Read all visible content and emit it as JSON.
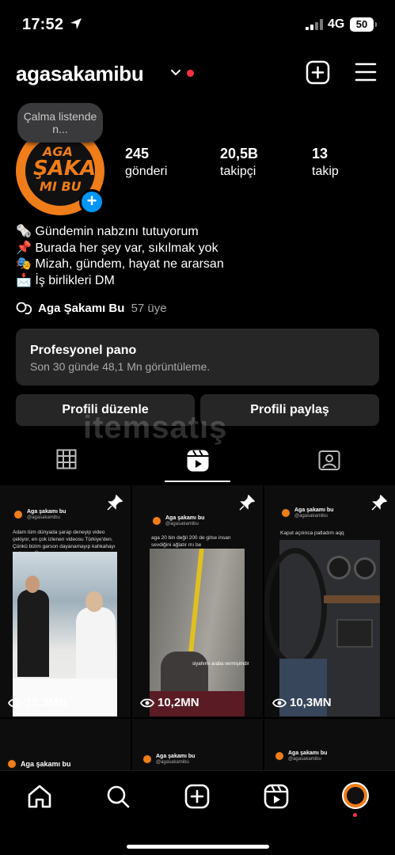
{
  "status_bar": {
    "time": "17:52",
    "network": "4G",
    "battery": "50"
  },
  "header": {
    "username": "agasakamibu"
  },
  "note": {
    "text": "Çalma listende n..."
  },
  "avatar": {
    "logo_lines": [
      "AGA",
      "ŞAKA",
      "MI BU"
    ]
  },
  "stats": [
    {
      "value": "245",
      "label": "gönderi"
    },
    {
      "value": "20,5B",
      "label": "takipçi"
    },
    {
      "value": "13",
      "label": "takip"
    }
  ],
  "bio": [
    "🗞️ Gündemin nabzını tutuyorum",
    "📌 Burada her şey var, sıkılmak yok",
    "🎭 Mizah, gündem, hayat ne ararsan",
    "📩 İş birlikleri DM"
  ],
  "community": {
    "name": "Aga Şakamı Bu",
    "count": "57 üye"
  },
  "professional_dashboard": {
    "title": "Profesyonel pano",
    "subtitle": "Son 30 günde 48,1 Mn görüntüleme."
  },
  "buttons": {
    "edit_profile": "Profili düzenle",
    "share_profile": "Profili paylaş"
  },
  "watermark": "itemsatış",
  "grid": [
    {
      "account_name": "Aga şakamı bu",
      "handle": "@agasakamibu",
      "caption": "Adam tüm dünyada şarap deneyip video çekiyor, en çok izlenen videosu Türkiye'den. Çünkü bizim garson dayanamayıp kahkahayı patlatıyo 😂",
      "views": "12,3MN"
    },
    {
      "account_name": "Aga şakamı bu",
      "handle": "@agasakamibu",
      "caption": "aga 20 bin değil 200 de gitse insan sevdiğini ağlatır mı be",
      "overlay": "siyahımı araba vermişimdir",
      "views": "10,2MN"
    },
    {
      "account_name": "Aga şakamı bu",
      "handle": "@agasakamibu",
      "caption": "Kaput açılınca patladım aqq",
      "views": "10,3MN"
    },
    {
      "account_name": "Aga şakamı bu"
    },
    {
      "account_name": "Aga şakamı bu",
      "handle": "@agasakamibu"
    },
    {
      "account_name": "Aga şakamı bu",
      "handle": "@agasakamibu"
    }
  ],
  "colors": {
    "accent": "#0095f6",
    "logo_orange": "#ef7d1a",
    "notification_red": "#ff3040",
    "panel": "#262626"
  }
}
